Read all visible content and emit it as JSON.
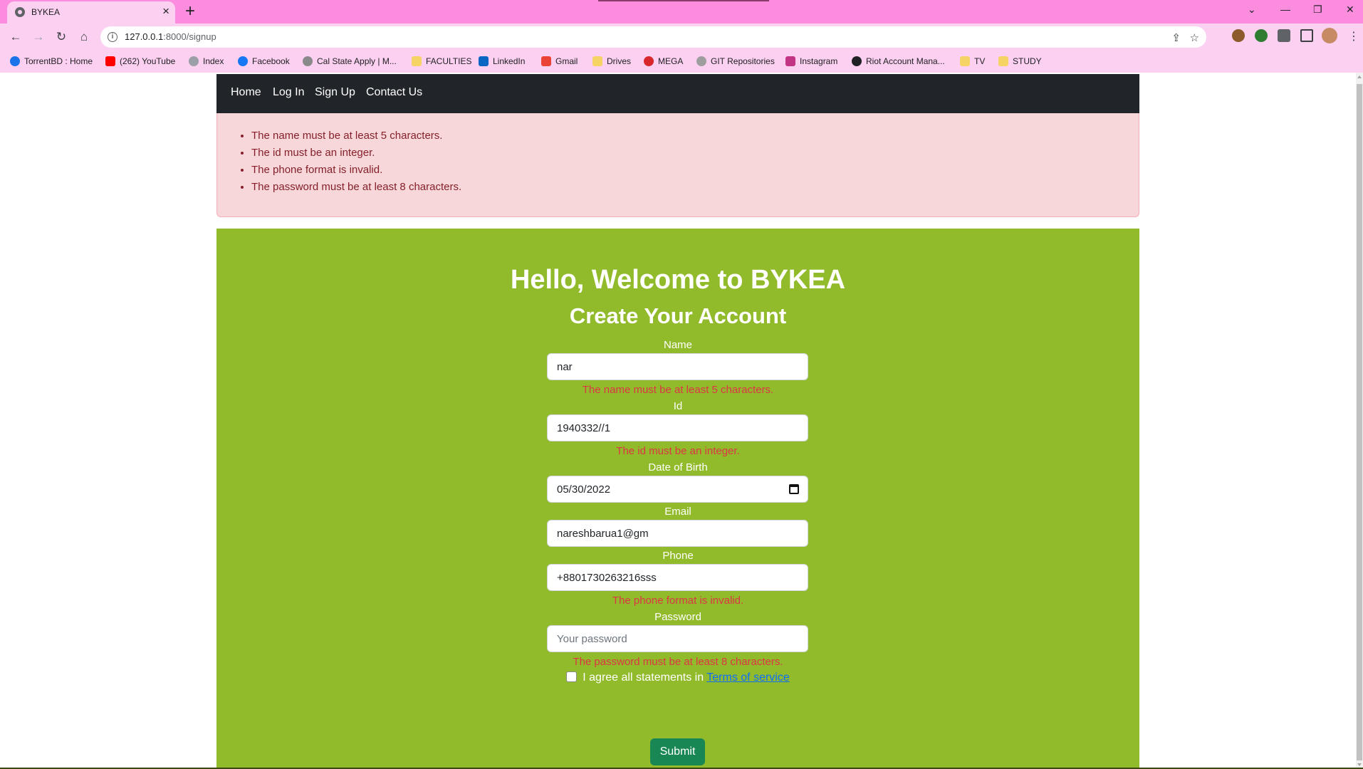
{
  "browser": {
    "tab_title": "BYKEA",
    "url_host": "127.0.0.1",
    "url_path": ":8000/signup",
    "bookmarks": [
      {
        "label": "TorrentBD : Home",
        "color": "#1a73e8"
      },
      {
        "label": "(262) YouTube",
        "color": "#ff0000"
      },
      {
        "label": "Index",
        "color": "#5f6368"
      },
      {
        "label": "Facebook",
        "color": "#1877f2"
      },
      {
        "label": "Cal State Apply | M...",
        "color": "#8a8a8a"
      },
      {
        "label": "FACULTIES",
        "color": "#f6d365"
      },
      {
        "label": "LinkedIn",
        "color": "#0a66c2"
      },
      {
        "label": "Gmail",
        "color": "#ea4335"
      },
      {
        "label": "Drives",
        "color": "#f6d365"
      },
      {
        "label": "MEGA",
        "color": "#d9272e"
      },
      {
        "label": "GIT Repositories",
        "color": "#9e9e9e"
      },
      {
        "label": "Instagram",
        "color": "#c13584"
      },
      {
        "label": "Riot Account Mana...",
        "color": "#202124"
      },
      {
        "label": "TV",
        "color": "#f6d365"
      },
      {
        "label": "STUDY",
        "color": "#f6d365"
      }
    ]
  },
  "navbar": {
    "home": "Home",
    "login": "Log In",
    "signup": "Sign Up",
    "contact": "Contact Us"
  },
  "alert": {
    "errors": [
      "The name must be at least 5 characters.",
      "The id must be an integer.",
      "The phone format is invalid.",
      "The password must be at least 8 characters."
    ]
  },
  "form": {
    "heading": "Hello, Welcome to BYKEA",
    "subheading": "Create Your Account",
    "name": {
      "label": "Name",
      "value": "nar",
      "error": "The name must be at least 5 characters."
    },
    "id": {
      "label": "Id",
      "value": "1940332//1",
      "error": "The id must be an integer."
    },
    "dob": {
      "label": "Date of Birth",
      "value": "05/30/2022"
    },
    "email": {
      "label": "Email",
      "value": "nareshbarua1@gm"
    },
    "phone": {
      "label": "Phone",
      "value": "+8801730263216sss",
      "error": "The phone format is invalid."
    },
    "password": {
      "label": "Password",
      "placeholder": "Your password",
      "error": "The password must be at least 8 characters."
    },
    "agree_text": "I agree all statements in ",
    "terms_link": "Terms of service",
    "submit_label": "Submit"
  },
  "colors": {
    "chrome": "#fb8cde",
    "navbar": "#212529",
    "panel": "#92bb2b",
    "alert_bg": "#f8d7da",
    "error_text": "#dc3545",
    "submit": "#198754"
  }
}
